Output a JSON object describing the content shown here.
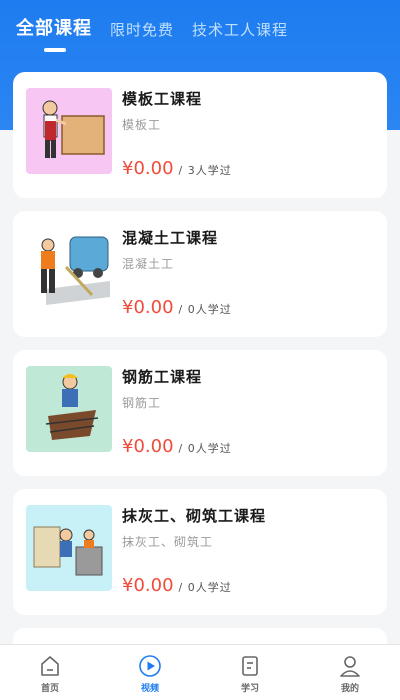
{
  "tabs": [
    {
      "label": "全部课程"
    },
    {
      "label": "限时免费"
    },
    {
      "label": "技术工人课程"
    }
  ],
  "courses": [
    {
      "title": "模板工课程",
      "subtitle": "模板工",
      "price": "¥0.00",
      "learners": "/ 3人学过",
      "thumb_bg": "#f7c6f2",
      "icon": "carpenter-illustration"
    },
    {
      "title": "混凝土工课程",
      "subtitle": "混凝土工",
      "price": "¥0.00",
      "learners": "/ 0人学过",
      "thumb_bg": "#ffffff",
      "icon": "concrete-worker-illustration"
    },
    {
      "title": "钢筋工课程",
      "subtitle": "钢筋工",
      "price": "¥0.00",
      "learners": "/ 0人学过",
      "thumb_bg": "#bfe9d6",
      "icon": "rebar-worker-illustration"
    },
    {
      "title": "抹灰工、砌筑工课程",
      "subtitle": "抹灰工、砌筑工",
      "price": "¥0.00",
      "learners": "/ 0人学过",
      "thumb_bg": "#c8f0f7",
      "icon": "plasterer-illustration"
    }
  ],
  "nav": [
    {
      "label": "首页",
      "icon": "home-icon"
    },
    {
      "label": "视频",
      "icon": "video-icon"
    },
    {
      "label": "学习",
      "icon": "study-icon"
    },
    {
      "label": "我的",
      "icon": "profile-icon"
    }
  ],
  "colors": {
    "primary": "#1e7cf0",
    "price": "#f24b3b"
  }
}
